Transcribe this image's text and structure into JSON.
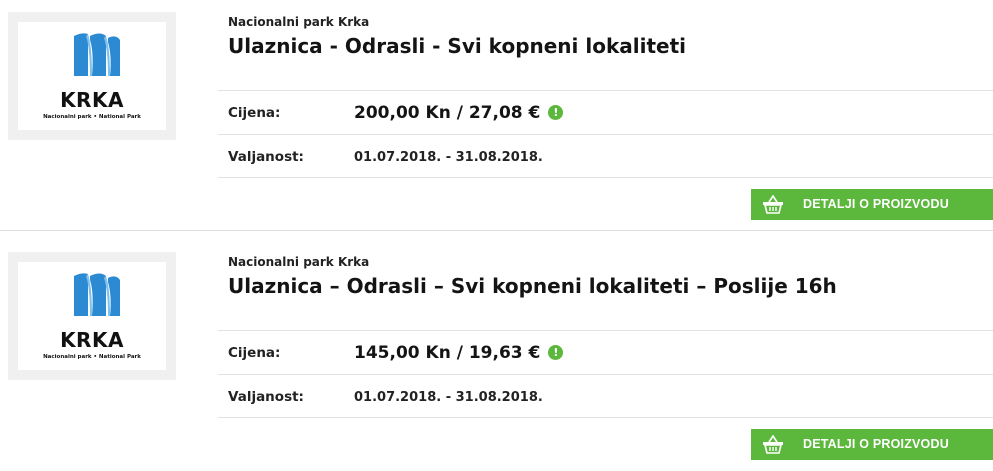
{
  "colors": {
    "accent_green": "#5cb83c",
    "logo_blue": "#2c8ad3"
  },
  "products": [
    {
      "logo_word": "KRKA",
      "logo_sub": "Nacionalni park • National Park",
      "brand": "Nacionalni park Krka",
      "title": "Ulaznica - Odrasli - Svi kopneni lokaliteti",
      "price_label": "Cijena:",
      "price": "200,00 Kn / 27,08 €",
      "info_icon": "!",
      "validity_label": "Valjanost:",
      "validity": "01.07.2018. - 31.08.2018.",
      "button_label": "DETALJI O PROIZVODU",
      "button_icon": "basket-icon"
    },
    {
      "logo_word": "KRKA",
      "logo_sub": "Nacionalni park • National Park",
      "brand": "Nacionalni park Krka",
      "title": "Ulaznica – Odrasli – Svi kopneni lokaliteti – Poslije 16h",
      "price_label": "Cijena:",
      "price": "145,00 Kn / 19,63 €",
      "info_icon": "!",
      "validity_label": "Valjanost:",
      "validity": "01.07.2018. - 31.08.2018.",
      "button_label": "DETALJI O PROIZVODU",
      "button_icon": "basket-icon"
    }
  ]
}
